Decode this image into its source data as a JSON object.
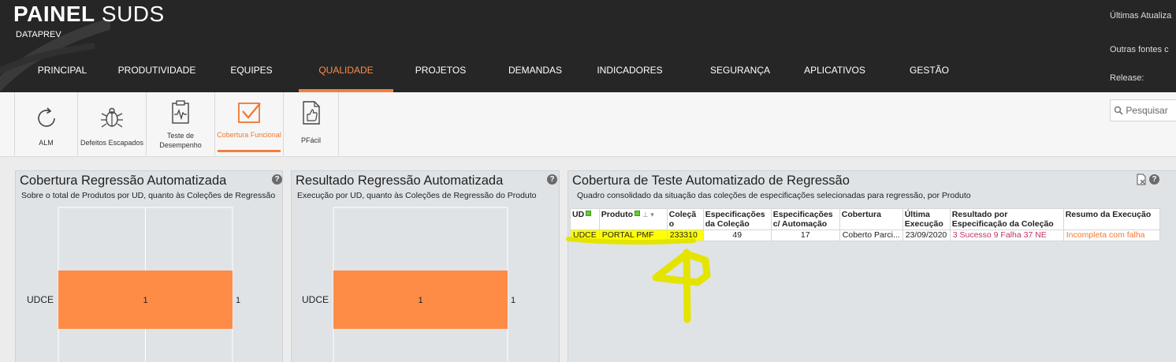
{
  "header": {
    "title_bold": "PAINEL",
    "title_rest": " SUDS",
    "subtitle": "DATAPREV",
    "nav": [
      {
        "label": "PRINCIPAL",
        "active": false
      },
      {
        "label": "PRODUTIVIDADE",
        "active": false
      },
      {
        "label": "EQUIPES",
        "active": false
      },
      {
        "label": "QUALIDADE",
        "active": true
      },
      {
        "label": "PROJETOS",
        "active": false
      },
      {
        "label": "DEMANDAS",
        "active": false
      },
      {
        "label": "INDICADORES",
        "active": false
      },
      {
        "label": "SEGURANÇA",
        "active": false
      },
      {
        "label": "APLICATIVOS",
        "active": false
      },
      {
        "label": "GESTÃO",
        "active": false
      }
    ],
    "meta": {
      "last_updates": "Últimas Atualiza",
      "other_sources": "Outras fontes c",
      "release": "Release:"
    }
  },
  "toolbar": {
    "items": [
      {
        "label": "ALM",
        "icon": "refresh-icon",
        "active": false
      },
      {
        "label": "Defeitos Escapados",
        "icon": "bug-icon",
        "active": false
      },
      {
        "label": "Teste de Desempenho",
        "icon": "clipboard-pulse-icon",
        "active": false
      },
      {
        "label": "Cobertura Funcional",
        "icon": "checkbox-icon",
        "active": true
      },
      {
        "label": "PFácil",
        "icon": "document-thumbs-up-icon",
        "active": false
      }
    ],
    "search_placeholder": "Pesquisar"
  },
  "panels": {
    "regressao": {
      "title": "Cobertura Regressão Automatizada",
      "subtitle": "Sobre o total de Produtos por UD, quanto às Coleções de Regressão"
    },
    "resultado": {
      "title": "Resultado Regressão Automatizada",
      "subtitle": "Execução por UD, quanto às Coleções de Regressão do Produto"
    },
    "cobertura": {
      "title": "Cobertura de Teste Automatizado de Regressão",
      "subtitle": "Quadro consolidado da situação das coleções de especificações selecionadas para regressão, por Produto"
    }
  },
  "table": {
    "headers": {
      "ud": "UD",
      "produto": "Produto",
      "colecao_1": "Coleçã",
      "colecao_2": "o",
      "espec_1": "Especificações",
      "espec_2": "da Coleção",
      "espec_auto_1": "Especificações",
      "espec_auto_2": "c/ Automação",
      "cobertura": "Cobertura",
      "ultima_1": "Última",
      "ultima_2": "Execução",
      "resultado_1": "Resultado por",
      "resultado_2": "Especificação da Coleção",
      "resumo": "Resumo da Execução"
    },
    "rows": [
      {
        "ud": "UDCE",
        "produto": "PORTAL PMF",
        "colecao": "233310",
        "especificacoes": "49",
        "automacao": "17",
        "cobertura": "Coberto Parci...",
        "ultima_execucao": "23/09/2020",
        "resultado": "3 Sucesso 9 Falha 37 NE",
        "resumo": "Incompleta com falha"
      }
    ]
  },
  "chart_data": [
    {
      "type": "bar",
      "orientation": "horizontal",
      "title": "Cobertura Regressão Automatizada",
      "categories": [
        "UDCE"
      ],
      "values": [
        1
      ],
      "value_labels": [
        "1"
      ],
      "end_labels": [
        "1"
      ],
      "bar_color": "#ff8c46",
      "grid": true
    },
    {
      "type": "bar",
      "orientation": "horizontal",
      "title": "Resultado Regressão Automatizada",
      "categories": [
        "UDCE"
      ],
      "values": [
        1
      ],
      "value_labels": [
        "1"
      ],
      "end_labels": [
        "1"
      ],
      "bar_color": "#ff8c46",
      "grid": false
    }
  ],
  "colors": {
    "accent": "#f08040",
    "bar": "#ff8c46",
    "header_bg": "#262626",
    "panel_bg": "#dfe3e6",
    "highlight": "#ffff00",
    "annotation": "#e4e400"
  }
}
